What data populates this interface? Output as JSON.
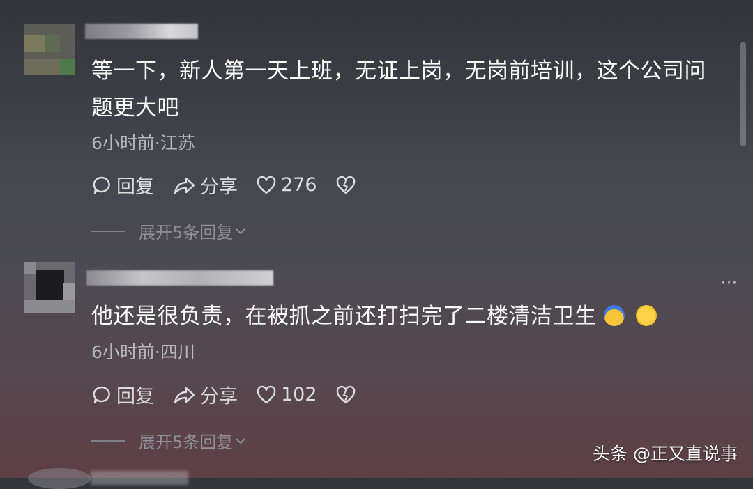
{
  "comments": [
    {
      "text": "等一下，新人第一天上班，无证上岗，无岗前培训，这个公司问题更大吧",
      "meta": "6小时前·江苏",
      "reply_label": "回复",
      "share_label": "分享",
      "likes": "276",
      "expand_label": "展开5条回复"
    },
    {
      "text": "他还是很负责，在被抓之前还打扫完了二楼清洁卫生",
      "emojis": [
        "face-with-sweat-icon",
        "kissing-face-icon"
      ],
      "meta": "6小时前·四川",
      "reply_label": "回复",
      "share_label": "分享",
      "likes": "102",
      "expand_label": "展开5条回复",
      "more_label": "···"
    }
  ],
  "watermark": "头条 @正又直说事",
  "colors": {
    "accent_text": "#ffffff",
    "meta_text": "#b8b8bc",
    "expand_text": "#8f8f95"
  }
}
